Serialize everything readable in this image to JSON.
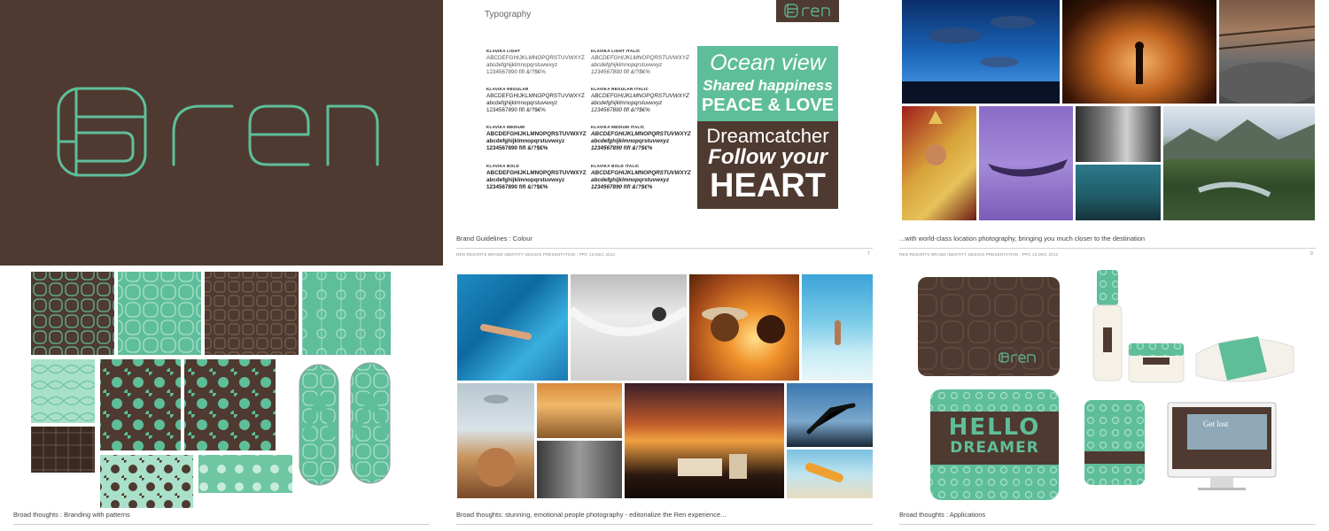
{
  "colors": {
    "brown": "#4e3a30",
    "green": "#5fbe9a",
    "page": "#ffffff"
  },
  "logo": {
    "text": "ren"
  },
  "typography": {
    "header": "Typography",
    "fonts": [
      {
        "name": "KLAVIKA LIGHT",
        "lines": [
          "ABCDEFGHIJKLMNOPQRSTUVWXYZ",
          "abcdefghijklmnopqrstuvwxyz",
          "1234567890 fifl &!?$€%"
        ]
      },
      {
        "name": "KLAVIKA LIGHT ITALIC",
        "lines": [
          "ABCDEFGHIJKLMNOPQRSTUVWXYZ",
          "abcdefghijklmnopqrstuvwxyz",
          "1234567890 fifl &!?$€%"
        ]
      },
      {
        "name": "KLAVIKA REGULAR",
        "lines": [
          "ABCDEFGHIJKLMNOPQRSTUVWXYZ",
          "abcdefghijklmnopqrstuvwxyz",
          "1234567890 fifl &!?$€%"
        ]
      },
      {
        "name": "KLAVIKA REGULAR ITALIC",
        "lines": [
          "ABCDEFGHIJKLMNOPQRSTUVWXYZ",
          "abcdefghijklmnopqrstuvwxyz",
          "1234567890 fifl &!?$€%"
        ]
      },
      {
        "name": "KLAVIKA MEDIUM",
        "lines": [
          "ABCDEFGHIJKLMNOPQRSTUVWXYZ",
          "abcdefghijklmnopqrstuvwxyz",
          "1234567890 fifl &!?$€%"
        ]
      },
      {
        "name": "KLAVIKA MEDIUM ITALIC",
        "lines": [
          "ABCDEFGHIJKLMNOPQRSTUVWXYZ",
          "abcdefghijklmnopqrstuvwxyz",
          "1234567890 fifl &!?$€%"
        ]
      },
      {
        "name": "KLAVIKA BOLD",
        "lines": [
          "ABCDEFGHIJKLMNOPQRSTUVWXYZ",
          "abcdefghijklmnopqrstuvwxyz",
          "1234567890 fifl &!?$€%"
        ]
      },
      {
        "name": "KLAVIKA BOLD ITALIC",
        "lines": [
          "ABCDEFGHIJKLMNOPQRSTUVWXYZ",
          "abcdefghijklmnopqrstuvwxyz",
          "1234567890 fifl &!?$€%"
        ]
      }
    ],
    "sample_green": [
      "Ocean view",
      "Shared happiness",
      "PEACE & LOVE"
    ],
    "sample_brown": [
      "Dreamcatcher",
      "Follow your",
      "HEART"
    ]
  },
  "captions": {
    "colour": "Brand Guidelines : Colour",
    "photography": "...with world-class location photography, bringing you much closer to the destination",
    "patterns": "Broad thoughts : Branding with patterns",
    "people": "Broad thoughts: stunning, emotional people photography - editorialize the Ren experience...",
    "applications": "Broad thoughts : Applications"
  },
  "footer": {
    "text": "REN RESORTS BRAND IDENTITY DESIGN PRESENTATION : PPC 13 DEC 2012",
    "page_colour": "7",
    "page_photo": "9"
  },
  "applications": {
    "hello": "HELLO",
    "dreamer": "DREAMER",
    "website": "Get lost"
  }
}
